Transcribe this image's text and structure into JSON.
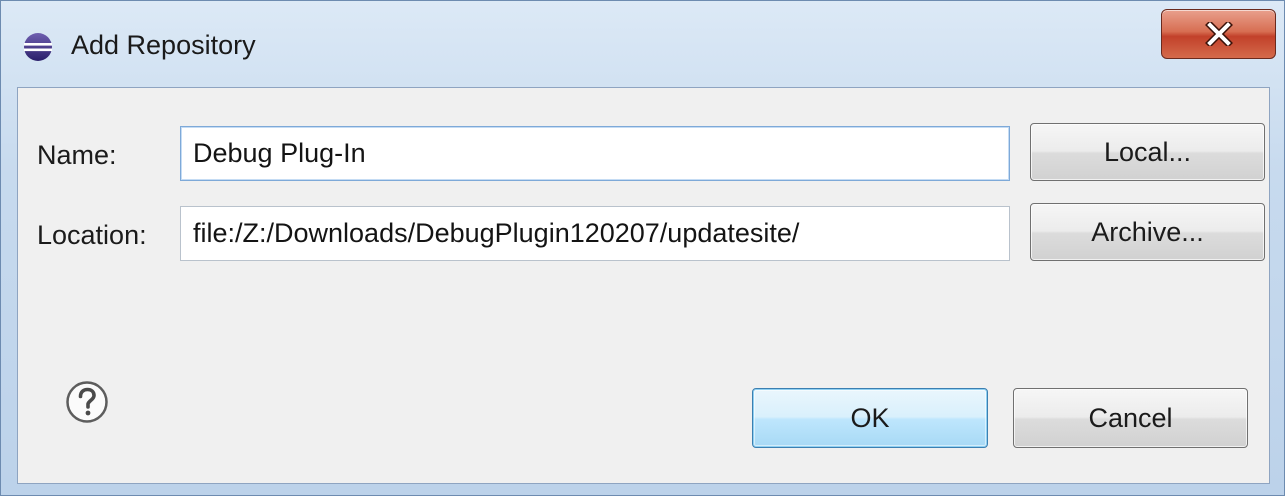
{
  "dialog": {
    "title": "Add Repository",
    "app_icon": "eclipse-icon",
    "close_icon": "close-x-icon"
  },
  "form": {
    "name_label": "Name:",
    "name_value": "Debug Plug-In",
    "location_label": "Location:",
    "location_value": "file:/Z:/Downloads/DebugPlugin120207/updatesite/"
  },
  "buttons": {
    "local": "Local...",
    "archive": "Archive...",
    "ok": "OK",
    "cancel": "Cancel"
  },
  "help": {
    "icon": "help-question-icon"
  },
  "colors": {
    "title_gradient_top": "#dce9f6",
    "client_background": "#f0f0f0",
    "close_button_red": "#c2412a",
    "default_button_blue": "#3c7fb1"
  }
}
